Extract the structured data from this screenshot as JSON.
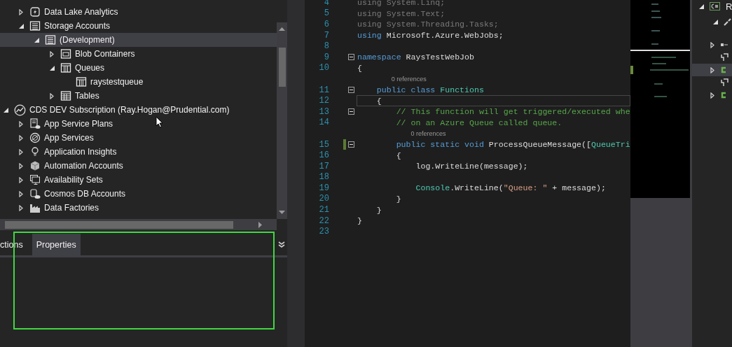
{
  "cloud_explorer": {
    "tree": {
      "continued_children": [
        {
          "label": "Data Lake Analytics",
          "expanded": false,
          "selected": false
        },
        {
          "label": "Storage Accounts",
          "expanded": true,
          "selected": false,
          "children": [
            {
              "label": "(Development)",
              "expanded": true,
              "selected": true,
              "children": [
                {
                  "label": "Blob Containers",
                  "expanded": false,
                  "selected": false
                },
                {
                  "label": "Queues",
                  "expanded": true,
                  "selected": false,
                  "children": [
                    {
                      "label": "raystestqueue",
                      "selected": false
                    }
                  ]
                },
                {
                  "label": "Tables",
                  "expanded": false,
                  "selected": false
                }
              ]
            }
          ]
        }
      ],
      "items": [
        {
          "label": "CDS DEV Subscription (Ray.Hogan@Prudential.com)",
          "expanded": true,
          "selected": false,
          "children": [
            {
              "label": "App Service Plans",
              "expanded": false,
              "selected": false
            },
            {
              "label": "App Services",
              "expanded": false,
              "selected": false
            },
            {
              "label": "Application Insights",
              "expanded": false,
              "selected": false
            },
            {
              "label": "Automation Accounts",
              "expanded": false,
              "selected": false
            },
            {
              "label": "Availability Sets",
              "expanded": false,
              "selected": false
            },
            {
              "label": "Cosmos DB Accounts",
              "expanded": false,
              "selected": false
            },
            {
              "label": "Data Factories",
              "expanded": false,
              "selected": false
            }
          ]
        }
      ]
    },
    "tabs": [
      {
        "label": "ctions",
        "selected": false
      },
      {
        "label": "Properties",
        "selected": true
      }
    ]
  },
  "editor": {
    "lines": [
      {
        "number": "4",
        "tokens": [
          {
            "kind": "faded",
            "text": "using System.Linq;"
          }
        ]
      },
      {
        "number": "5",
        "tokens": [
          {
            "kind": "faded",
            "text": "using System.Text;"
          }
        ]
      },
      {
        "number": "6",
        "tokens": [
          {
            "kind": "faded",
            "text": "using System.Threading.Tasks;"
          }
        ]
      },
      {
        "number": "7",
        "tokens": [
          {
            "kind": "keyword",
            "text": "using"
          },
          {
            "kind": "plain",
            "text": " Microsoft.Azure.WebJobs;"
          }
        ]
      },
      {
        "number": "8"
      },
      {
        "number": "9",
        "fold": true,
        "tokens": [
          {
            "kind": "keyword",
            "text": "namespace"
          },
          {
            "kind": "plain",
            "text": " RaysTestWebJob"
          }
        ]
      },
      {
        "number": "10",
        "tokens": [
          {
            "kind": "plain",
            "text": "{"
          }
        ]
      },
      {
        "number": "11",
        "fold": true,
        "codelens": "0 references",
        "tokens": [
          {
            "kind": "keyword",
            "text": "    public class"
          },
          {
            "kind": "type",
            "text": " Functions"
          }
        ]
      },
      {
        "number": "12",
        "current": true,
        "tokens": [
          {
            "kind": "plain",
            "text": "    {"
          }
        ]
      },
      {
        "number": "13",
        "fold": true,
        "tokens": [
          {
            "kind": "comment",
            "text": "        // This function will get triggered/executed whe"
          }
        ]
      },
      {
        "number": "14",
        "tokens": [
          {
            "kind": "comment",
            "text": "        // on an Azure Queue called queue."
          }
        ]
      },
      {
        "number": "15",
        "fold": true,
        "changed": true,
        "codelens": "0 references",
        "tokens": [
          {
            "kind": "keyword",
            "text": "        public static void"
          },
          {
            "kind": "plain",
            "text": " ProcessQueueMessage(["
          },
          {
            "kind": "type",
            "text": "QueueTri"
          }
        ]
      },
      {
        "number": "16",
        "tokens": [
          {
            "kind": "plain",
            "text": "        {"
          }
        ]
      },
      {
        "number": "17",
        "tokens": [
          {
            "kind": "plain",
            "text": "            log.WriteLine(message);"
          }
        ]
      },
      {
        "number": "18"
      },
      {
        "number": "19",
        "tokens": [
          {
            "kind": "type",
            "text": "            Console"
          },
          {
            "kind": "plain",
            "text": ".WriteLine("
          },
          {
            "kind": "string",
            "text": "\"Queue: \""
          },
          {
            "kind": "plain",
            "text": " + message);"
          }
        ]
      },
      {
        "number": "20",
        "tokens": [
          {
            "kind": "plain",
            "text": "        }"
          }
        ]
      },
      {
        "number": "21",
        "tokens": [
          {
            "kind": "plain",
            "text": "    }"
          }
        ]
      },
      {
        "number": "22",
        "tokens": [
          {
            "kind": "plain",
            "text": "}"
          }
        ]
      },
      {
        "number": "23"
      }
    ]
  },
  "solution_explorer": {
    "items": [
      {
        "label": "R",
        "expanded": true,
        "selected": false,
        "children": [
          {
            "expanded": true,
            "selected": false
          },
          {
            "expanded": false,
            "selected": false
          },
          {
            "selected": false
          },
          {
            "expanded": false,
            "selected": true
          },
          {
            "selected": false
          },
          {
            "expanded": false,
            "selected": false
          }
        ]
      }
    ]
  }
}
